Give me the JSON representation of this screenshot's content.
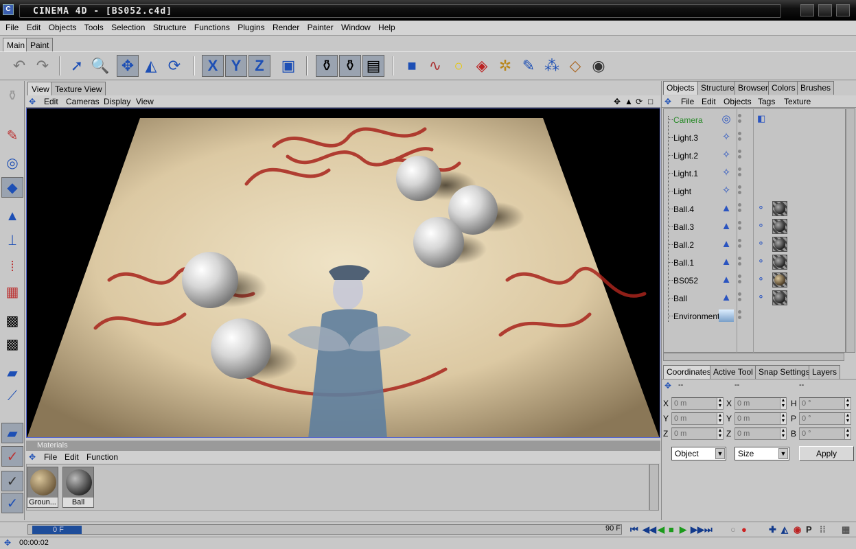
{
  "window": {
    "title": "CINEMA 4D - [BS052.c4d]"
  },
  "menubar": [
    "File",
    "Edit",
    "Objects",
    "Tools",
    "Selection",
    "Structure",
    "Functions",
    "Plugins",
    "Render",
    "Painter",
    "Window",
    "Help"
  ],
  "main_tabs": [
    "Main",
    "Paint"
  ],
  "viewport": {
    "tabs": [
      "View",
      "Texture View"
    ],
    "menu": [
      "Edit",
      "Cameras",
      "Display",
      "View"
    ]
  },
  "materials": {
    "header": "Materials",
    "menu": [
      "File",
      "Edit",
      "Function"
    ],
    "items": [
      {
        "label": "Groun..."
      },
      {
        "label": "Ball"
      }
    ]
  },
  "objects_panel": {
    "tabs": [
      "Objects",
      "Structure",
      "Browser",
      "Colors",
      "Brushes"
    ],
    "menu": [
      "File",
      "Edit",
      "Objects",
      "Tags",
      "Texture"
    ],
    "items": [
      {
        "name": "Camera",
        "icon": "camera-icon",
        "highlight": true
      },
      {
        "name": "Light.3",
        "icon": "light-icon"
      },
      {
        "name": "Light.2",
        "icon": "light-icon"
      },
      {
        "name": "Light.1",
        "icon": "light-icon"
      },
      {
        "name": "Light",
        "icon": "light-icon"
      },
      {
        "name": "Ball.4",
        "icon": "sphere-icon"
      },
      {
        "name": "Ball.3",
        "icon": "sphere-icon"
      },
      {
        "name": "Ball.2",
        "icon": "sphere-icon"
      },
      {
        "name": "Ball.1",
        "icon": "sphere-icon"
      },
      {
        "name": "BS052",
        "icon": "sphere-icon"
      },
      {
        "name": "Ball",
        "icon": "sphere-icon"
      },
      {
        "name": "Environment",
        "icon": "environment-icon"
      }
    ]
  },
  "coordinates": {
    "tabs": [
      "Coordinates",
      "Active Tool",
      "Snap Settings",
      "Layers"
    ],
    "col_headers": [
      "--",
      "--",
      "--"
    ],
    "rows": [
      {
        "pos_label": "X",
        "pos": "0 m",
        "size_label": "X",
        "size": "0 m",
        "rot_label": "H",
        "rot": "0 °"
      },
      {
        "pos_label": "Y",
        "pos": "0 m",
        "size_label": "Y",
        "size": "0 m",
        "rot_label": "P",
        "rot": "0 °"
      },
      {
        "pos_label": "Z",
        "pos": "0 m",
        "size_label": "Z",
        "size": "0 m",
        "rot_label": "B",
        "rot": "0 °"
      }
    ],
    "mode_select": "Object",
    "size_select": "Size",
    "apply_label": "Apply"
  },
  "timeline": {
    "current_frame": "0 F",
    "end_frame": "90 F"
  },
  "status": {
    "time": "00:00:02"
  },
  "colors": {
    "accent": "#1e4d9a",
    "camera_text": "#2a8a2a",
    "icon_blue": "#2a54c0"
  }
}
